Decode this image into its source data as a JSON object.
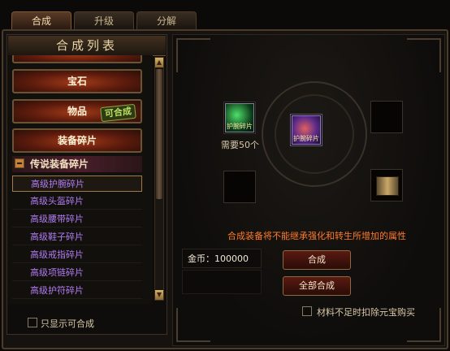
{
  "tabs": [
    {
      "label": "合成",
      "active": true
    },
    {
      "label": "升级",
      "active": false
    },
    {
      "label": "分解",
      "active": false
    }
  ],
  "list": {
    "title": "合成列表",
    "categories": [
      {
        "label": "宝石"
      },
      {
        "label": "物品",
        "badge": "可合成"
      },
      {
        "label": "装备碎片"
      }
    ],
    "subcategory": "传说装备碎片",
    "subitems": [
      {
        "label": "高级护腕碎片",
        "selected": true
      },
      {
        "label": "高级头盔碎片",
        "selected": false
      },
      {
        "label": "高级腰带碎片",
        "selected": false
      },
      {
        "label": "高级鞋子碎片",
        "selected": false
      },
      {
        "label": "高级戒指碎片",
        "selected": false
      },
      {
        "label": "高级项链碎片",
        "selected": false
      },
      {
        "label": "高级护符碎片",
        "selected": false
      }
    ],
    "show_only_craftable": "只显示可合成"
  },
  "craft": {
    "required_count": "需要50个",
    "input_item_label": "护腕碎片",
    "result_item_label": "护腕碎片",
    "note": "合成装备将不能继承强化和转生所增加的属性",
    "gold_label": "金币：",
    "gold_value": "100000",
    "craft_button": "合成",
    "craft_all_button": "全部合成",
    "auto_buy_label": "材料不足时扣除元宝购买"
  },
  "colors": {
    "accent_orange": "#ff7a2a",
    "item_purple": "#b07cf0",
    "badge_green": "#b9e065"
  },
  "icons": [
    "minus-icon",
    "scroll-up-arrow-icon",
    "scroll-down-arrow-icon",
    "green-gem-fragment-icon",
    "purple-gem-fragment-icon",
    "scroll-item-icon"
  ]
}
